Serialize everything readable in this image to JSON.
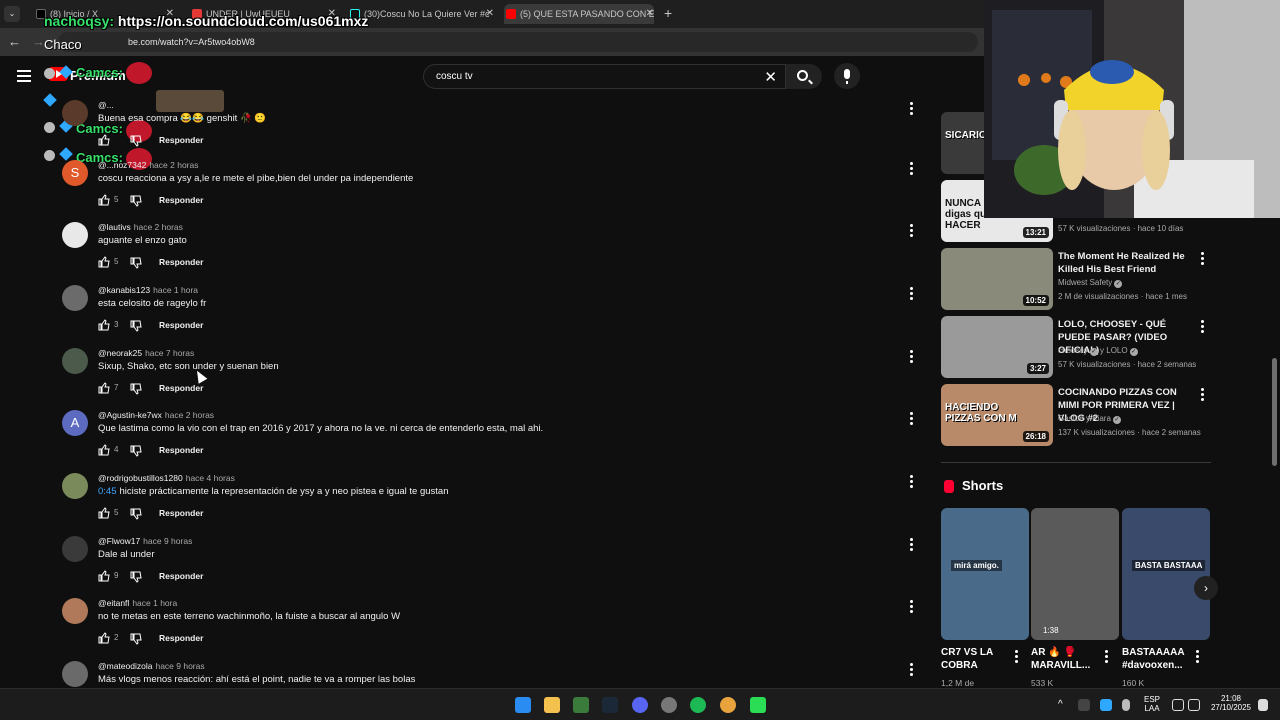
{
  "browser": {
    "tabs": [
      {
        "label": "(8) Inicio / X",
        "active": false
      },
      {
        "label": "UNDER | UwUEUEU",
        "active": false
      },
      {
        "label": "(30)Coscu No La Quiere Ver #c",
        "active": false
      },
      {
        "label": "(5) QUE ESTA PASANDO CON E",
        "active": true
      }
    ],
    "url": "be.com/watch?v=Ar5two4obW8",
    "new_tab": "+",
    "close": "✕"
  },
  "overlay": {
    "chat_nick": "nachoqsy:",
    "chat_url": "https://on.soundcloud.com/us061mxz",
    "chaco": "Chaco",
    "camcs": "Camcs:"
  },
  "youtube": {
    "premium_label": "Premium",
    "search": {
      "query": "coscu tv",
      "clear": "✕"
    }
  },
  "comments": [
    {
      "author": "@...",
      "time": "",
      "text": "Buena esa compra 😂😂 genshit 🥀 🙂",
      "likes": "",
      "reply": "Responder",
      "avatar_letter": "",
      "avatar_color": "#5a3a2a"
    },
    {
      "author": "@...noz7342",
      "time": "hace 2 horas",
      "text": "coscu reacciona a ysy a,le re mete el pibe,bien del under pa independiente",
      "likes": "5",
      "reply": "Responder",
      "avatar_letter": "S",
      "avatar_color": "#e0592a"
    },
    {
      "author": "@lautivs",
      "time": "hace 2 horas",
      "text": "aguante el enzo gato",
      "likes": "5",
      "reply": "Responder",
      "avatar_letter": "",
      "avatar_color": "#e8e8e8"
    },
    {
      "author": "@kanabis123",
      "time": "hace 1 hora",
      "text": "esta celosito de rageylo fr",
      "likes": "3",
      "reply": "Responder",
      "avatar_letter": "",
      "avatar_color": "#6b6b6b"
    },
    {
      "author": "@neorak25",
      "time": "hace 7 horas",
      "text": "Sixup, Shako, etc son under y suenan bien",
      "likes": "7",
      "reply": "Responder",
      "avatar_letter": "",
      "avatar_color": "#4b5a4b"
    },
    {
      "author": "@Agustin-ke7wx",
      "time": "hace 2 horas",
      "text": "Que lastima como la vio con el trap en 2016 y 2017 y ahora no la ve. ni cerca de entenderlo esta, mal ahi.",
      "likes": "4",
      "reply": "Responder",
      "avatar_letter": "A",
      "avatar_color": "#5c6bc0"
    },
    {
      "author": "@rodrigobustillos1280",
      "time": "hace 4 horas",
      "timestamp": "0:45",
      "text": "hiciste prácticamente la representación de ysy a y neo pistea e igual te gustan",
      "likes": "5",
      "reply": "Responder",
      "avatar_letter": "",
      "avatar_color": "#7b8a5a"
    },
    {
      "author": "@Flwow17",
      "time": "hace 9 horas",
      "text": "Dale al under",
      "likes": "9",
      "reply": "Responder",
      "avatar_letter": "",
      "avatar_color": "#3a3a3a"
    },
    {
      "author": "@eitanfl",
      "time": "hace 1 hora",
      "text": "no te metas en este terreno wachinmoño, la fuiste a buscar al angulo W",
      "likes": "2",
      "reply": "Responder",
      "avatar_letter": "",
      "avatar_color": "#b07a5a"
    },
    {
      "author": "@mateodizola",
      "time": "hace 9 horas",
      "text": "Más vlogs menos reacción: ahí está el point, nadie te va a romper las bolas",
      "likes": "",
      "reply": "Responder",
      "avatar_letter": "",
      "avatar_color": "#6a6a6a"
    }
  ],
  "related": [
    {
      "title": "",
      "channel": "",
      "meta": "",
      "duration": "",
      "thumb_color": "#3a3a3a",
      "overlay_text": "SICARIO EN A"
    },
    {
      "title": "",
      "channel": "",
      "meta": "57 K visualizaciones · hace 10 días",
      "duration": "13:21",
      "thumb_color": "#e8e8e8",
      "overlay_text": "NUNCA Me digas que HACER"
    },
    {
      "title": "The Moment He Realized He Killed His Best Friend",
      "channel": "Midwest Safety",
      "meta": "2 M de visualizaciones · hace 1 mes",
      "duration": "10:52",
      "thumb_color": "#8a8a7a",
      "overlay_text": ""
    },
    {
      "title": "LOLO, CHOOSEY - QUÉ PUEDE PASAR? (VIDEO OFICIAL)",
      "channel": "choosey",
      "channel2": "y LOLO",
      "meta": "57 K visualizaciones · hace 2 semanas",
      "duration": "3:27",
      "thumb_color": "#9a9a9a",
      "overlay_text": ""
    },
    {
      "title": "COCINANDO PIZZAS CON MIMI POR PRIMERA VEZ | VLOG #2",
      "channel": "Gaston y Kiara",
      "meta": "137 K visualizaciones · hace 2 semanas",
      "duration": "26:18",
      "thumb_color": "#b88a6a",
      "overlay_text": "HACIENDO PIZZAS CON M"
    }
  ],
  "shorts": {
    "heading": "Shorts",
    "items": [
      {
        "title": "CR7 VS LA COBRA",
        "views": "1,2 M de",
        "color": "#4a6a8a",
        "caption": "mirá amigo.",
        "badge": ""
      },
      {
        "title": "AR 🔥 🥊 MARAVILL...",
        "views": "533 K",
        "color": "#5a5a5a",
        "caption": "",
        "badge": "1:38"
      },
      {
        "title": "BASTAAAAA #davooxen...",
        "views": "160 K",
        "color": "#3a4a6a",
        "caption": "BASTA BASTAAA",
        "badge": ""
      }
    ],
    "next": "›"
  },
  "taskbar": {
    "lang_top": "ESP",
    "lang_bottom": "LAA",
    "time": "21:08",
    "date": "27/10/2025"
  }
}
